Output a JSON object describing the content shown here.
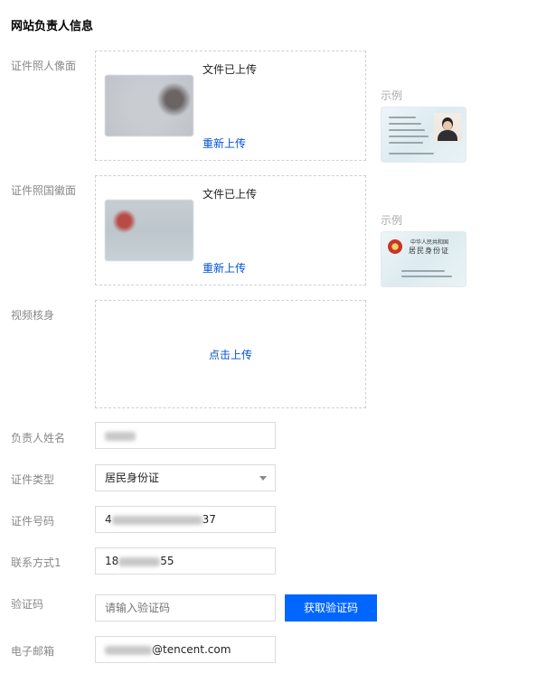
{
  "section_title": "网站负责人信息",
  "id_front": {
    "label": "证件照人像面",
    "status": "文件已上传",
    "reupload": "重新上传",
    "example_label": "示例"
  },
  "id_back": {
    "label": "证件照国徽面",
    "status": "文件已上传",
    "reupload": "重新上传",
    "example_label": "示例",
    "card_line1": "中华人民共和国",
    "card_line2": "居民身份证"
  },
  "video": {
    "label": "视频核身",
    "upload_link": "点击上传"
  },
  "name": {
    "label": "负责人姓名"
  },
  "id_type": {
    "label": "证件类型",
    "value": "居民身份证"
  },
  "id_number": {
    "label": "证件号码",
    "prefix": "4",
    "suffix": "37"
  },
  "contact": {
    "label": "联系方式1",
    "prefix": "18",
    "suffix": "55"
  },
  "verify": {
    "label": "验证码",
    "placeholder": "请输入验证码",
    "button": "获取验证码"
  },
  "email": {
    "label": "电子邮箱",
    "suffix": "@tencent.com"
  },
  "colors": {
    "primary_button": "#0066ff",
    "link": "#0052d9"
  }
}
